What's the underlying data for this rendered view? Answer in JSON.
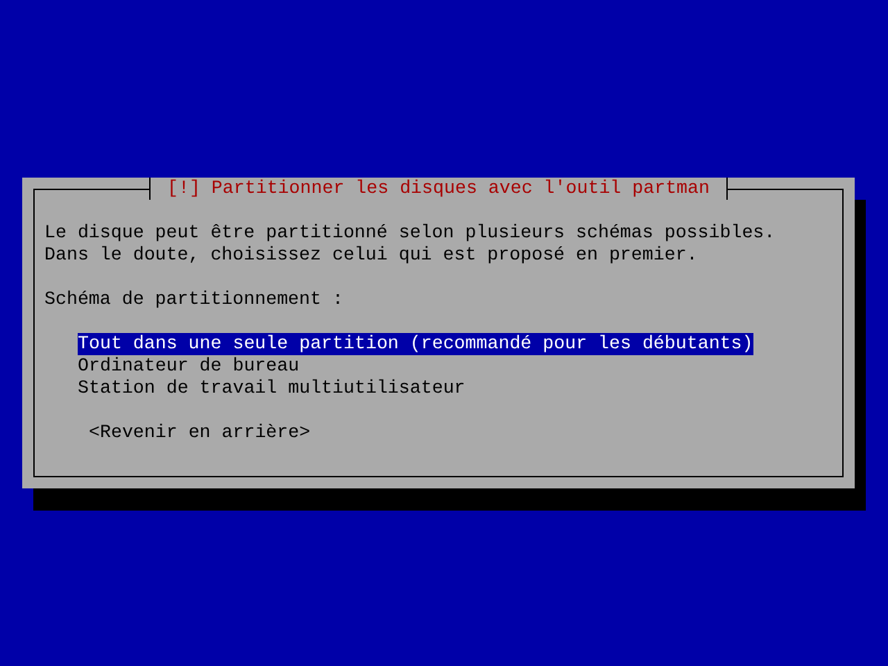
{
  "dialog": {
    "title": "[!] Partitionner les disques avec l'outil partman",
    "description": [
      "Le disque peut être partitionné selon plusieurs schémas possibles.",
      "Dans le doute, choisissez celui qui est proposé en premier."
    ],
    "prompt": "Schéma de partitionnement :",
    "options": [
      {
        "label": "Tout dans une seule partition (recommandé pour les débutants)",
        "selected": true
      },
      {
        "label": "Ordinateur de bureau",
        "selected": false
      },
      {
        "label": "Station de travail multiutilisateur",
        "selected": false
      }
    ],
    "buttons": [
      "<Revenir en arrière>"
    ]
  }
}
